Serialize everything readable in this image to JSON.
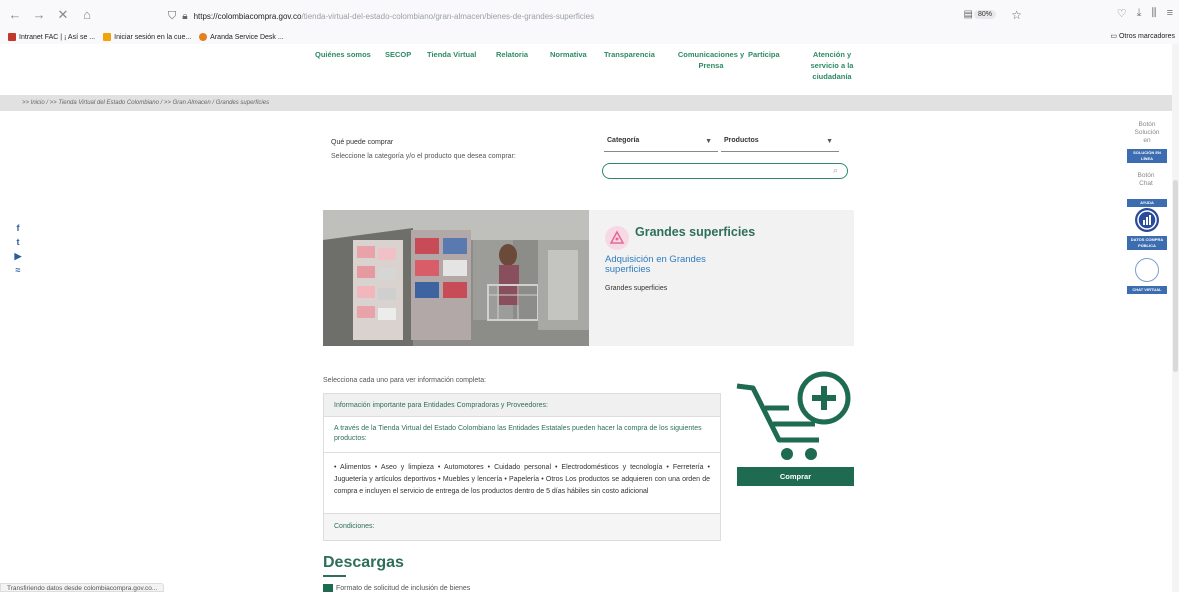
{
  "browser": {
    "nav_back": "←",
    "nav_forward": "→",
    "nav_stop": "✕",
    "nav_home": "⌂",
    "url_host": "https://colombiacompra.gov.co",
    "url_path": "/tienda-virtual-del-estado-colombiano/gran-almacen/bienes-de-grandes-superficies",
    "zoom": "80%",
    "bookmarks": [
      {
        "label": "Intranet FAC | ¡ Así se ...",
        "color": "#c0392b"
      },
      {
        "label": "Iniciar sesión en la cue...",
        "color": "#f0a30a"
      },
      {
        "label": "Aranda Service Desk ...",
        "color": "#e67e22"
      }
    ],
    "other_bookmarks": "Otros marcadores",
    "status": "Transfiriendo datos desde colombiacompra.gov.co..."
  },
  "site_nav": {
    "items": [
      "Quiénes somos",
      "SECOP",
      "Tienda Virtual",
      "Relatoria",
      "Normativa",
      "Transparencia",
      "Comunicaciones y Prensa",
      "Participa",
      "Atención y servicio a la ciudadanía"
    ]
  },
  "breadcrumb": ">> Inicio / >> Tienda Virtual del Estado Colombiano / >> Gran Almacen / Grandes superficies",
  "purchase": {
    "title": "Qué puede comprar",
    "subtitle": "Seleccione la categoría y/o el producto que desea comprar:",
    "category_select": "Categoría",
    "products_select": "Productos",
    "search_placeholder": ""
  },
  "category_card": {
    "title": "Grandes superficies",
    "subtitle": "Adquisición en Grandes superficies",
    "description": "Grandes superficies"
  },
  "info": {
    "hint": "Selecciona cada uno para ver información completa:",
    "header": "Información importante para Entidades Compradoras y Proveedores:",
    "intro": "A través de la Tienda Virtual del Estado Colombiano las Entidades Estatales pueden hacer la compra de los siguientes productos:",
    "products": "• Alimentos • Aseo y limpieza • Automotores • Cuidado personal • Electrodomésticos y tecnología • Ferretería • Juguetería y artículos deportivos • Muebles y lencería • Papelería • Otros Los productos se adquieren con una orden de compra e incluyen el servicio de entrega de los productos dentro de 5 días hábiles sin costo adicional",
    "conditions": "Condiciones:"
  },
  "buy_button": "Comprar",
  "downloads": {
    "title": "Descargas",
    "first_item": "Formato de solicitud de inclusión de bienes"
  },
  "right_widgets": {
    "boton_solucion": "Botón Solución en",
    "solucion_tag": "SOLUCIÓN EN LÍNEA",
    "boton_chat": "Botón Chat",
    "ayuda_tag": "AYUDA",
    "datos_tag": "DATOS COMPRA PÚBLICA",
    "chat_tag": "CHAT VIRTUAL"
  },
  "social": {
    "facebook": "f",
    "twitter": "t",
    "youtube": "▶",
    "rss": "≈"
  },
  "colors": {
    "brand_green": "#2d8b64",
    "dark_green": "#1f6b51",
    "link_blue": "#2d7cbf",
    "widget_blue": "#3c6db0"
  }
}
